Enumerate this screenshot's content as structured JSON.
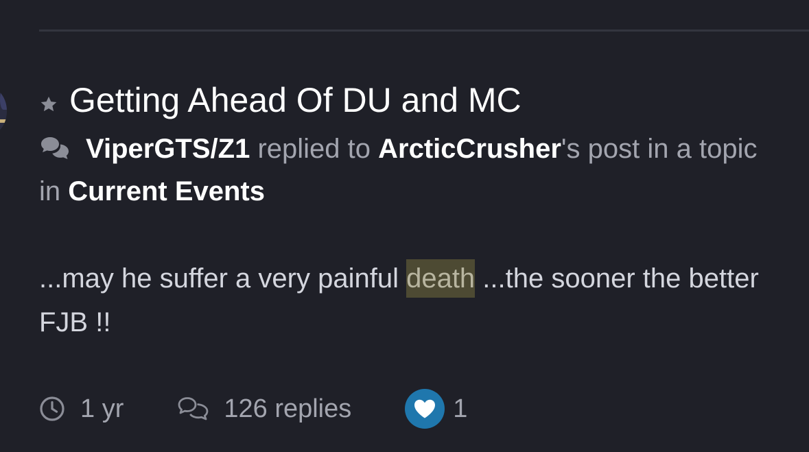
{
  "post": {
    "title": "Getting Ahead Of DU and MC",
    "author": "ViperGTS/Z1",
    "action_text": " replied to ",
    "target_user": "ArcticCrusher",
    "possessive_text": "'s post in a topic in ",
    "forum": "Current Events",
    "snippet_before": "...may he suffer a very painful ",
    "snippet_highlight": "death",
    "snippet_after": " ...the sooner the better FJB !!"
  },
  "footer": {
    "time": "1 yr",
    "replies": "126 replies",
    "reaction_count": "1"
  },
  "icons": {
    "title": "star-icon",
    "meta": "chat-bubbles-icon",
    "time": "clock-icon",
    "replies": "replies-icon",
    "reaction": "heart-icon"
  },
  "colors": {
    "background": "#1f2028",
    "muted_text": "#a3a5af",
    "highlight": "#4d4a33",
    "reaction_badge": "#1f77ad"
  }
}
